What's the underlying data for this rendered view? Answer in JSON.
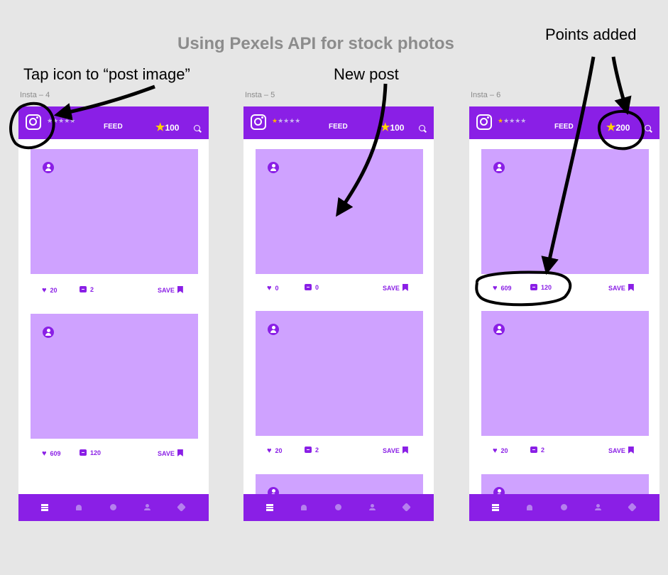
{
  "page_title": "Using Pexels API for stock photos",
  "annotations": {
    "tap_icon": "Tap icon to “post image”",
    "new_post": "New post",
    "points_added": "Points added"
  },
  "screens": [
    {
      "artboard": "Insta – 4",
      "feed_label": "FEED",
      "stars": "★★★★★",
      "points": "100",
      "posts": [
        {
          "likes": "20",
          "comments": "2",
          "save": "SAVE"
        },
        {
          "likes": "609",
          "comments": "120",
          "save": "SAVE"
        }
      ]
    },
    {
      "artboard": "Insta – 5",
      "feed_label": "FEED",
      "stars": "★★★★★",
      "points": "100",
      "posts": [
        {
          "likes": "0",
          "comments": "0",
          "save": "SAVE"
        },
        {
          "likes": "20",
          "comments": "2",
          "save": "SAVE"
        }
      ]
    },
    {
      "artboard": "Insta – 6",
      "feed_label": "FEED",
      "stars": "★★★★★",
      "points": "200",
      "posts": [
        {
          "likes": "609",
          "comments": "120",
          "save": "SAVE"
        },
        {
          "likes": "20",
          "comments": "2",
          "save": "SAVE"
        }
      ]
    }
  ],
  "icons": {
    "logo": "instagram-icon",
    "search": "search-icon",
    "points_star": "star-icon",
    "like": "heart-icon",
    "comment": "comment-icon",
    "save": "bookmark-icon",
    "nav": [
      "feed-icon",
      "bell-icon",
      "explore-icon",
      "user-icon",
      "settings-icon"
    ]
  },
  "colors": {
    "brand": "#8a1fe6",
    "image_placeholder": "#cfa2ff",
    "star_accent": "#ffd400",
    "canvas": "#e6e6e6"
  }
}
